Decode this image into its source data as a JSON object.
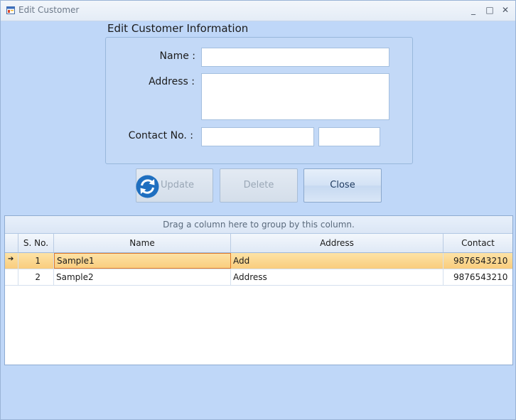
{
  "window": {
    "title": "Edit Customer",
    "icon": "form-window-icon",
    "controls": [
      "minimize-icon",
      "maximize-icon",
      "close-icon"
    ],
    "minimize_glyph": "_",
    "maximize_glyph": "□",
    "close_glyph": "✕"
  },
  "form": {
    "heading": "Edit Customer Information",
    "name_label": "Name :",
    "address_label": "Address :",
    "contact_label": "Contact No. :",
    "name_value": "",
    "address_value": "",
    "contact_value": "",
    "contact_ext_value": ""
  },
  "buttons": {
    "update_label": "Update",
    "delete_label": "Delete",
    "close_label": "Close",
    "update_icon": "refresh-icon"
  },
  "grid": {
    "group_panel_text": "Drag a column here to group by this column.",
    "columns": [
      "S. No.",
      "Name",
      "Address",
      "Contact"
    ],
    "rows": [
      {
        "sno": "1",
        "name": "Sample1",
        "address": "Add",
        "contact": "9876543210"
      },
      {
        "sno": "2",
        "name": "Sample2",
        "address": "Address",
        "contact": "9876543210"
      }
    ],
    "selected_row": 1,
    "row_indicator_glyph": "➔"
  },
  "colors": {
    "background": "#bfd7f8",
    "selected_row": "#fbd58f",
    "focus_border": "#e07a2a",
    "icon_blue": "#1f6fc0"
  }
}
